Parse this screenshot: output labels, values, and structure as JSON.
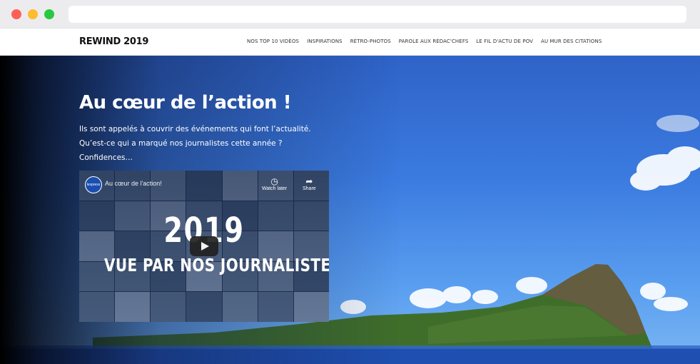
{
  "site": {
    "brand": "REWIND 2019",
    "menu": [
      "NOS TOP 10 VIDÉOS",
      "INSPIRATIONS",
      "RÉTRO-PHOTOS",
      "PAROLE AUX RÉDAC'CHEFS",
      "LE FIL D'ACTU DE POV",
      "AU MUR DES CITATIONS"
    ]
  },
  "hero": {
    "title": "Au cœur de l’action !",
    "text_lines": [
      "Ils sont appelés à couvrir des événements qui font l’actualité.",
      "Qu’est-ce qui a marqué nos journalistes cette année ?",
      "Confidences…"
    ]
  },
  "video": {
    "channel_logo": "lexpress",
    "title": "Au cœur de l'action!",
    "watch_later": "Watch later",
    "share": "Share",
    "headline_year": "2019",
    "headline_sub": "VUE PAR NOS JOURNALISTES"
  },
  "icons": {
    "clock": "clock-icon",
    "share": "share-icon",
    "play": "play-icon"
  },
  "colors": {
    "window_close": "#fe5f57",
    "window_minimize": "#febc2e",
    "window_maximize": "#28c840",
    "sky": "#3b7be0",
    "sea": "#1f4fb0"
  }
}
